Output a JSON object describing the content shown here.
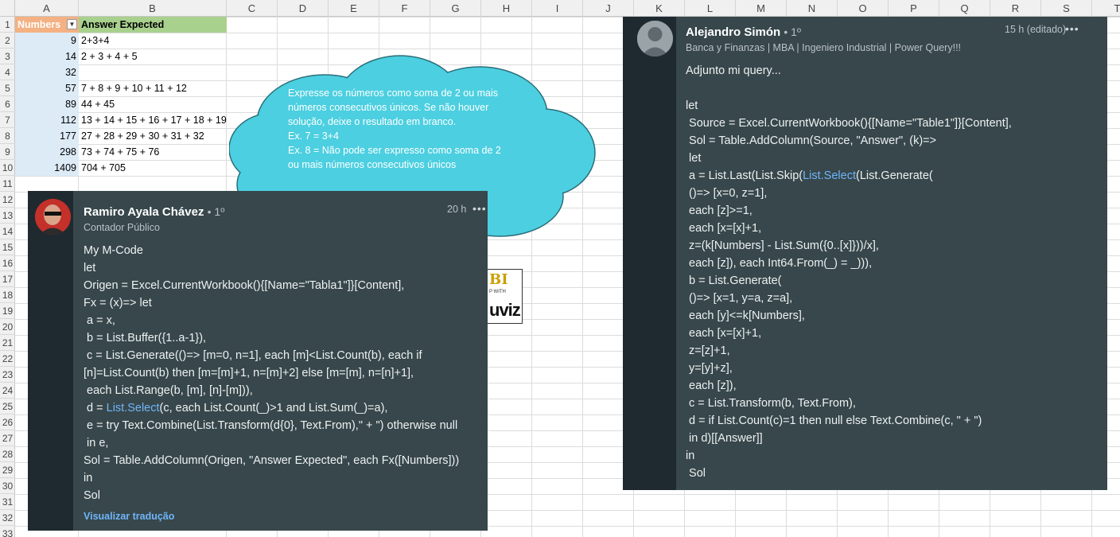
{
  "spreadsheet": {
    "columns": [
      "A",
      "B",
      "C",
      "D",
      "E",
      "F",
      "G",
      "H",
      "I",
      "J",
      "K",
      "L",
      "M",
      "N",
      "O",
      "P",
      "Q",
      "R",
      "S",
      "T"
    ],
    "rows": [
      "1",
      "2",
      "3",
      "4",
      "5",
      "6",
      "7",
      "8",
      "9",
      "10",
      "11",
      "12",
      "13",
      "14",
      "15",
      "16",
      "17",
      "18",
      "19",
      "20",
      "21",
      "22",
      "23",
      "24",
      "25",
      "26",
      "27",
      "28",
      "29",
      "30",
      "31",
      "32",
      "33"
    ],
    "table": {
      "header_numbers": "Numbers",
      "header_answer": "Answer Expected",
      "numbers": [
        "9",
        "14",
        "32",
        "57",
        "89",
        "112",
        "177",
        "298",
        "1409"
      ],
      "answers": [
        "2+3+4",
        "2 + 3 + 4 + 5",
        "",
        "7 + 8 + 9 + 10 + 11 + 12",
        "44 + 45",
        "13 + 14 + 15 + 16 + 17 + 18 + 19",
        "27 + 28 + 29 + 30 + 31 + 32",
        "73 + 74 + 75 + 76",
        "704 + 705"
      ]
    }
  },
  "cloud": {
    "lines": [
      "Expresse os números como soma de 2 ou mais",
      "números consecutivos únicos. Se não houver",
      "solução, deixe o resultado em branco.",
      "Ex. 7 = 3+4",
      "Ex. 8 = Não pode ser expresso como soma de 2",
      "ou mais números consecutivos únicos"
    ],
    "color": "#4ccfe0"
  },
  "logo": {
    "top": "BI",
    "mid": "P WITH",
    "bottom": "uviz"
  },
  "comment_left": {
    "name": "Ramiro Ayala Chávez",
    "degree": "• 1º",
    "headline": "Contador Público",
    "time": "20 h",
    "more": "•••",
    "lines": [
      "My M-Code",
      "let",
      "Origen = Excel.CurrentWorkbook(){[Name=\"Tabla1\"]}[Content],",
      "Fx = (x)=> let",
      " a = x,",
      " b = List.Buffer({1..a-1}),",
      " c = List.Generate(()=> [m=0, n=1], each [m]<List.Count(b), each if",
      "[n]=List.Count(b) then [m=[m]+1, n=[m]+2] else [m=[m], n=[n]+1],",
      " each List.Range(b, [m], [n]-[m])),",
      " d = ",
      " e = try Text.Combine(List.Transform(d{0}, Text.From),\" + \") otherwise null",
      " in e,",
      "Sol = Table.AddColumn(Origen, \"Answer Expected\", each Fx([Numbers]))",
      "in",
      "Sol"
    ],
    "d_highlight": "List.Select",
    "d_rest": "(c, each List.Count(_)>1 and List.Sum(_)=a),",
    "translate_link": "Visualizar tradução"
  },
  "comment_right": {
    "name": "Alejandro Simón",
    "degree": "• 1º",
    "headline": "Banca y Finanzas | MBA | Ingeniero Industrial | Power Query!!!",
    "time": "15 h (editado)",
    "more": "•••",
    "lines": [
      "Adjunto mi query...",
      "",
      "let",
      " Source = Excel.CurrentWorkbook(){[Name=\"Table1\"]}[Content],",
      " Sol = Table.AddColumn(Source, \"Answer\", (k)=>",
      " let",
      " a = ",
      " ()=> [x=0, z=1],",
      " each [z]>=1,",
      " each [x=[x]+1,",
      " z=(k[Numbers] - List.Sum({0..[x]}))/x],",
      " each [z]), each Int64.From(_) = _))),",
      " b = List.Generate(",
      " ()=> [x=1, y=a, z=a],",
      " each [y]<=k[Numbers],",
      " each [x=[x]+1,",
      " z=[z]+1,",
      " y=[y]+z],",
      " each [z]),",
      " c = List.Transform(b, Text.From),",
      " d = if List.Count(c)=1 then null else Text.Combine(c, \" + \")",
      " in d)[[Answer]]",
      "in",
      " Sol"
    ],
    "a_pre": "List.Last(List.Skip(",
    "a_highlight": "List.Select",
    "a_post": "(List.Generate("
  }
}
